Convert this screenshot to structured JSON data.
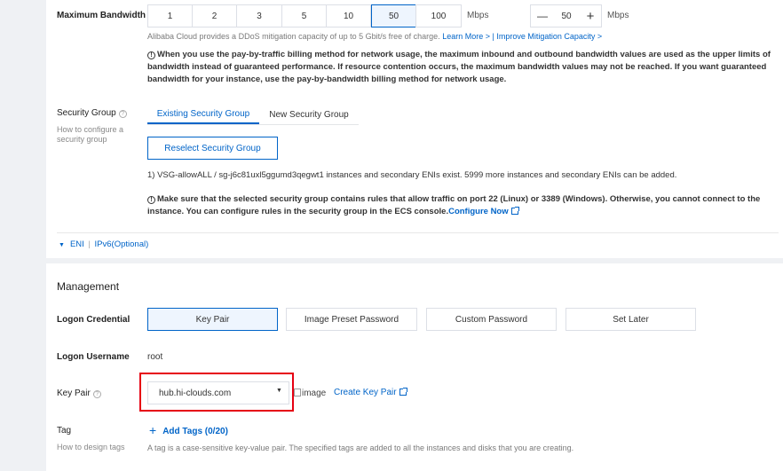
{
  "bandwidth": {
    "label": "Maximum Bandwidth",
    "options": [
      "1",
      "2",
      "3",
      "5",
      "10",
      "50",
      "100"
    ],
    "unit": "Mbps",
    "stepper_value": "50",
    "stepper_unit": "Mbps",
    "minus": "—",
    "plus": "+",
    "ddos_text": "Alibaba Cloud provides a DDoS mitigation capacity of up to 5 Gbit/s free of charge.",
    "learn_more": "Learn More >",
    "separator": " | ",
    "improve_link": "Improve Mitigation Capacity >",
    "notice": "When you use the pay-by-traffic billing method for network usage, the maximum inbound and outbound bandwidth values are used as the upper limits of bandwidth instead of guaranteed performance. If resource contention occurs, the maximum bandwidth values may not be reached. If you want guaranteed bandwidth for your instance, use the pay-by-bandwidth billing method for network usage."
  },
  "security_group": {
    "label": "Security Group",
    "help": "How to configure a security group",
    "tabs": [
      "Existing Security Group",
      "New Security Group"
    ],
    "reselect": "Reselect Security Group",
    "info": "1) VSG-allowALL / sg-j6c81uxl5ggumd3qegwt1 instances and secondary ENIs exist. 5999 more instances and secondary ENIs can be added.",
    "notice": "Make sure that the selected security group contains rules that allow traffic on port 22 (Linux) or 3389 (Windows). Otherwise, you cannot connect to the instance. You can configure rules in the security group in the ECS console.",
    "configure_link": "Configure Now"
  },
  "eni": {
    "label": "ENI",
    "sep": "|",
    "ipv6": "IPv6(Optional)"
  },
  "management": {
    "title": "Management",
    "logon_label": "Logon Credential",
    "logon_options": [
      "Key Pair",
      "Image Preset Password",
      "Custom Password",
      "Set Later"
    ],
    "username_label": "Logon Username",
    "username_value": "root",
    "keypair_label": "Key Pair",
    "keypair_value": "hub.hi-clouds.com",
    "image_alt": "image",
    "create_keypair": "Create Key Pair",
    "tag_label": "Tag",
    "tag_help": "How to design tags",
    "add_tags": "Add Tags (0/20)",
    "tag_hint": "A tag is a case-sensitive key-value pair. The specified tags are added to all the instances and disks that you are creating."
  },
  "colors": {
    "accent": "#0064c8",
    "highlight": "#e60012"
  }
}
